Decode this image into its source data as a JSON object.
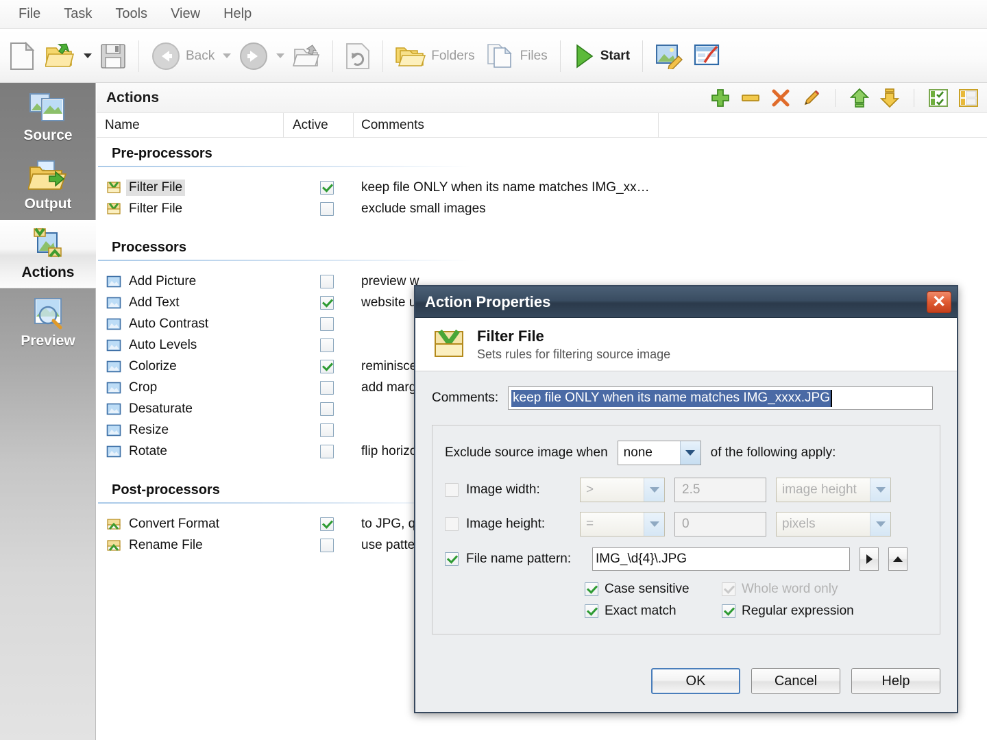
{
  "menu": {
    "items": [
      {
        "label": "File"
      },
      {
        "label": "Task"
      },
      {
        "label": "Tools"
      },
      {
        "label": "View"
      },
      {
        "label": "Help"
      }
    ]
  },
  "toolbar": {
    "new_tooltip": "new-document",
    "open_label": "open-folder",
    "save_label": "save",
    "back_label": "Back",
    "forward_label": "forward",
    "up_label": "up-one-level",
    "refresh_label": "refresh",
    "folders_label": "Folders",
    "files_label": "Files",
    "start_label": "Start",
    "edit_image_label": "edit-image",
    "report_label": "report"
  },
  "sidebar": {
    "items": [
      {
        "label": "Source",
        "icon": "images-icon",
        "selected": false
      },
      {
        "label": "Output",
        "icon": "output-folder-icon",
        "selected": false
      },
      {
        "label": "Actions",
        "icon": "actions-icon",
        "selected": true
      },
      {
        "label": "Preview",
        "icon": "preview-magnifier-icon",
        "selected": false
      }
    ]
  },
  "panel": {
    "title": "Actions",
    "tools": [
      {
        "name": "add-action-button",
        "icon": "plus-icon"
      },
      {
        "name": "remove-action-button",
        "icon": "minus-icon"
      },
      {
        "name": "delete-action-button",
        "icon": "x-icon"
      },
      {
        "name": "edit-action-button",
        "icon": "pencil-icon"
      },
      {
        "name": "move-up-button",
        "icon": "arrow-up-icon"
      },
      {
        "name": "move-down-button",
        "icon": "arrow-down-icon"
      },
      {
        "name": "check-all-button",
        "icon": "check-all-icon"
      },
      {
        "name": "uncheck-all-button",
        "icon": "uncheck-all-icon"
      }
    ],
    "columns": {
      "name": "Name",
      "active": "Active",
      "comments": "Comments"
    },
    "groups": [
      {
        "title": "Pre-processors",
        "icon": "filter-file-icon",
        "rows": [
          {
            "name": "Filter File",
            "active": true,
            "comments": "keep file ONLY when its name matches IMG_xx…",
            "selected": true
          },
          {
            "name": "Filter File",
            "active": false,
            "comments": "exclude small images",
            "selected": false
          }
        ]
      },
      {
        "title": "Processors",
        "icon": "picture-icon",
        "rows": [
          {
            "name": "Add Picture",
            "active": false,
            "comments": "preview w",
            "selected": false
          },
          {
            "name": "Add Text",
            "active": true,
            "comments": "website u",
            "selected": false
          },
          {
            "name": "Auto Contrast",
            "active": false,
            "comments": "",
            "selected": false
          },
          {
            "name": "Auto Levels",
            "active": false,
            "comments": "",
            "selected": false
          },
          {
            "name": "Colorize",
            "active": true,
            "comments": "reminisce",
            "selected": false
          },
          {
            "name": "Crop",
            "active": false,
            "comments": "add marg",
            "selected": false
          },
          {
            "name": "Desaturate",
            "active": false,
            "comments": "",
            "selected": false
          },
          {
            "name": "Resize",
            "active": false,
            "comments": "",
            "selected": false
          },
          {
            "name": "Rotate",
            "active": false,
            "comments": "flip horizo",
            "selected": false
          }
        ]
      },
      {
        "title": "Post-processors",
        "icon": "convert-icon",
        "rows": [
          {
            "name": "Convert Format",
            "active": true,
            "comments": "to JPG, q",
            "selected": false
          },
          {
            "name": "Rename File",
            "active": false,
            "comments": "use patte",
            "selected": false
          }
        ]
      }
    ]
  },
  "dialog": {
    "title": "Action Properties",
    "close_label": "✕",
    "header_title": "Filter File",
    "header_subtitle": "Sets rules for filtering source image",
    "comments_label": "Comments:",
    "comments_value": "keep file ONLY when its name matches IMG_xxxx.JPG",
    "exclude_label_before": "Exclude source image when",
    "exclude_mode": "none",
    "exclude_label_after": "of the following apply:",
    "rows": [
      {
        "name": "image-width",
        "label": "Image width:",
        "checked": false,
        "enabled": false,
        "operator": ">",
        "value": "2.5",
        "unit": "image height"
      },
      {
        "name": "image-height",
        "label": "Image height:",
        "checked": false,
        "enabled": false,
        "operator": "=",
        "value": "0",
        "unit": "pixels"
      }
    ],
    "pattern_label": "File name pattern:",
    "pattern_checked": true,
    "pattern_value": "IMG_\\d{4}\\.JPG",
    "options": [
      {
        "label": "Case sensitive",
        "checked": true,
        "enabled": true
      },
      {
        "label": "Whole word only",
        "checked": true,
        "enabled": false
      },
      {
        "label": "Exact match",
        "checked": true,
        "enabled": true
      },
      {
        "label": "Regular expression",
        "checked": true,
        "enabled": true
      }
    ],
    "buttons": {
      "ok": "OK",
      "cancel": "Cancel",
      "help": "Help"
    }
  },
  "colors": {
    "accent_blue": "#4a6aa5",
    "title_bar": "#37485d",
    "close_red": "#e05b32",
    "check_green": "#2e9b33",
    "sidebar_dark": "#7c7c7c"
  }
}
